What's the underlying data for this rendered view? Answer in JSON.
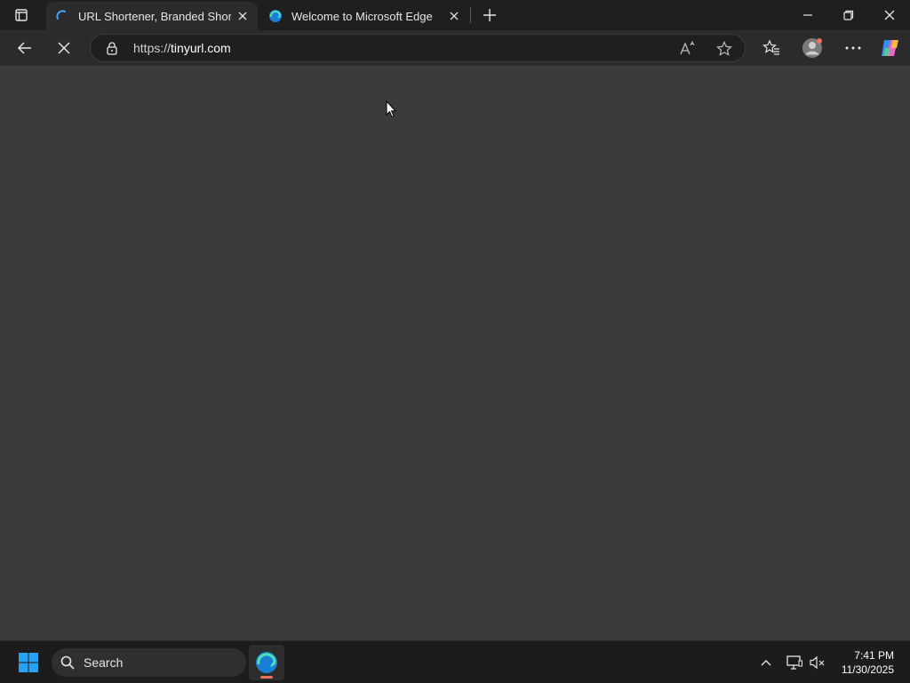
{
  "browser": {
    "tabs": [
      {
        "title": "URL Shortener, Branded Short Links",
        "active": true,
        "loading": true
      },
      {
        "title": "Welcome to Microsoft Edge",
        "active": false
      }
    ],
    "address": {
      "scheme": "https://",
      "host": "tinyurl.com"
    },
    "icons": {
      "tab_actions": "tab-actions-icon",
      "new_tab": "plus-icon",
      "minimize": "minimize-icon",
      "restore": "restore-icon",
      "close": "close-icon",
      "back": "back-arrow-icon",
      "stop": "stop-loading-icon",
      "lock": "lock-icon",
      "read_aloud": "read-aloud-icon",
      "favorite": "star-icon",
      "favorites": "favorites-icon",
      "profile": "profile-icon",
      "menu": "more-icon",
      "copilot": "copilot-icon"
    }
  },
  "taskbar": {
    "search_label": "Search",
    "time": "7:41 PM",
    "date": "11/30/2025",
    "icons": {
      "start": "windows-start-icon",
      "search": "search-icon",
      "edge": "edge-icon",
      "tray_overflow": "chevron-up-icon",
      "network": "network-icon",
      "volume": "volume-muted-icon"
    }
  },
  "colors": {
    "content_bg": "#3b3b3b",
    "tabstrip_bg": "#1f1f1f",
    "toolbar_bg": "#2b2b2b",
    "taskbar_bg": "#1c1c1c",
    "windows_blue": "#2aa1f0",
    "edge_indicator": "#e9735f"
  }
}
